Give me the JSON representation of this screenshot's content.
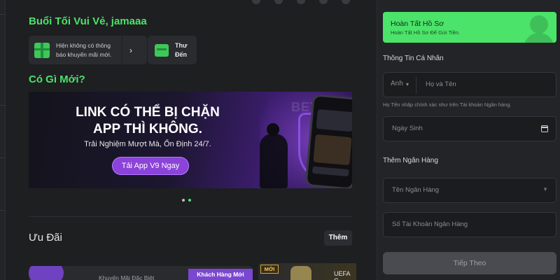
{
  "greeting": "Buổi Tối Vui Vẻ, jamaaa",
  "promo_notice": {
    "text": "Hiện không có thông báo khuyến mãi mới.",
    "chevron": "›"
  },
  "inbox": {
    "label": "Thư Đến"
  },
  "whats_new": "Có Gì Mới?",
  "banner": {
    "headline": "LINK CÓ THỂ BỊ CHẶN APP THÌ KHÔNG.",
    "subline": "Trải Nghiệm Mượt Mà, Ổn Định 24/7.",
    "cta": "Tải App V9 Ngay",
    "watermark": "BET V9"
  },
  "carousel": {
    "count": 2,
    "active": 1
  },
  "offers": {
    "title": "Ưu Đãi",
    "more": "Thêm",
    "card1": {
      "title": "Khuyến Mãi Đặc Biệt",
      "tag": "Khách Hàng Mới"
    },
    "card2": {
      "badge": "MỚI",
      "text": "UEFA C..."
    }
  },
  "profile": {
    "complete_title": "Hoàn Tất Hồ Sơ",
    "complete_sub": "Hoàn Tất Hồ Sơ Để Gửi Tiền.",
    "personal_section": "Thông Tin Cá Nhân",
    "title_select": "Anh",
    "fullname_placeholder": "Họ và Tên",
    "fullname_hint": "Họ Tên nhập chính xác như trên Tài khoản Ngân hàng.",
    "dob_placeholder": "Ngày Sinh",
    "bank_section": "Thêm Ngân Hàng",
    "bank_name_placeholder": "Tên Ngân Hàng",
    "account_placeholder": "Số Tài Khoản Ngân Hàng",
    "submit": "Tiếp Theo"
  },
  "colors": {
    "accent_green": "#4be36a",
    "banner_purple": "#8b43d9",
    "background": "#1e1f21"
  }
}
